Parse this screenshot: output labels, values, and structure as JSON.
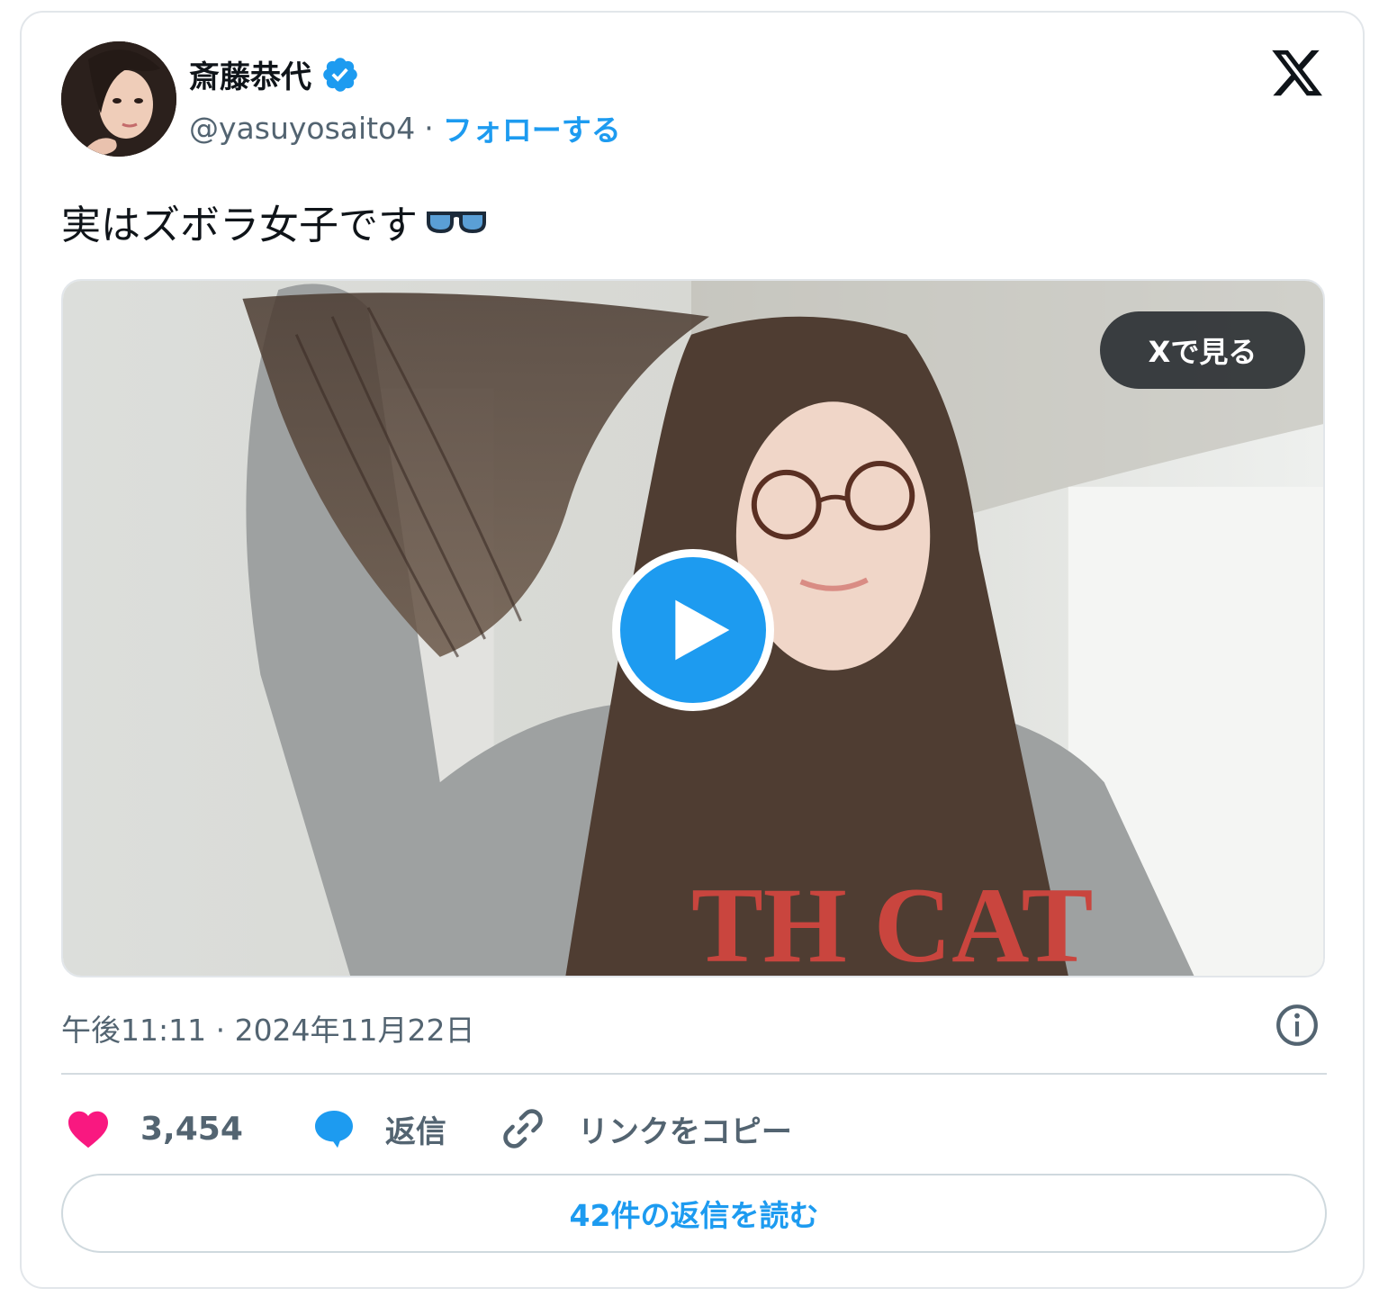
{
  "author": {
    "display_name": "斎藤恭代",
    "handle": "@yasuyosaito4",
    "separator": "·",
    "follow_label": "フォローする",
    "verified_icon": "verified-badge-icon",
    "verified_color": "#1d9bf0"
  },
  "brand_icon": "x-logo-icon",
  "tweet": {
    "text": "実はズボラ女子です",
    "emoji_icon": "glasses-emoji-icon"
  },
  "media": {
    "view_on_x_label": "Xで見る",
    "play_icon": "play-icon",
    "shirt_print": "TH CAT"
  },
  "timestamp": "午後11:11 · 2024年11月22日",
  "info_icon": "info-icon",
  "actions": {
    "like_count": "3,454",
    "like_icon": "heart-icon",
    "like_color": "#f91880",
    "reply_label": "返信",
    "reply_icon": "speech-bubble-icon",
    "copy_link_label": "リンクをコピー",
    "copy_link_icon": "link-icon"
  },
  "read_replies_label": "42件の返信を読む",
  "colors": {
    "accent": "#1d9bf0",
    "secondary_text": "#536471",
    "border": "#e2e6ea"
  }
}
